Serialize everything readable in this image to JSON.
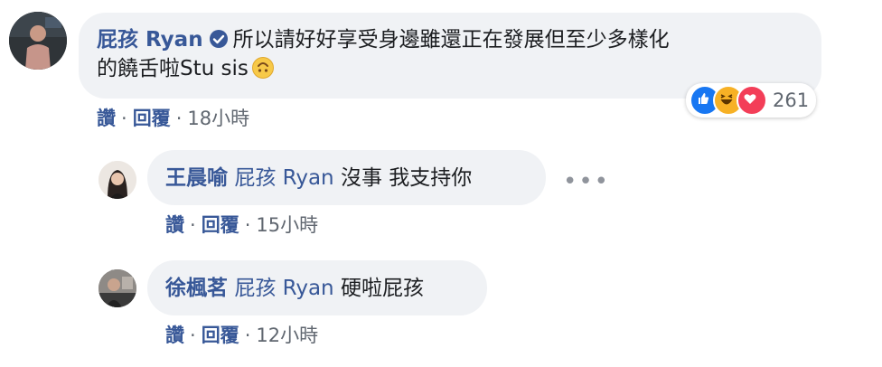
{
  "comment": {
    "author": "屁孩 Ryan",
    "line1": "所以請好好享受身邊雖還正在發展但至少多樣化",
    "line2": "的饒舌啦Stu sis",
    "reaction_count": "261",
    "actions": {
      "like": "讚",
      "reply": "回覆",
      "time": "18小時"
    }
  },
  "replies": [
    {
      "author": "王晨喻",
      "mention": "屁孩 Ryan",
      "text": "沒事 我支持你",
      "more": "•••",
      "actions": {
        "like": "讚",
        "reply": "回覆",
        "time": "15小時"
      }
    },
    {
      "author": "徐楓茗",
      "mention": "屁孩 Ryan",
      "text": "硬啦屁孩",
      "actions": {
        "like": "讚",
        "reply": "回覆",
        "time": "12小時"
      }
    }
  ],
  "icons": {
    "verified": "verified-badge-icon",
    "emoji": "upside-down-face-emoji",
    "reactions": [
      "like-reaction-icon",
      "haha-reaction-icon",
      "love-reaction-icon"
    ]
  },
  "colors": {
    "author": "#385898",
    "bubble": "#f0f2f5",
    "like": "#1877f2",
    "love": "#f33e58",
    "haha": "#f7b125"
  }
}
